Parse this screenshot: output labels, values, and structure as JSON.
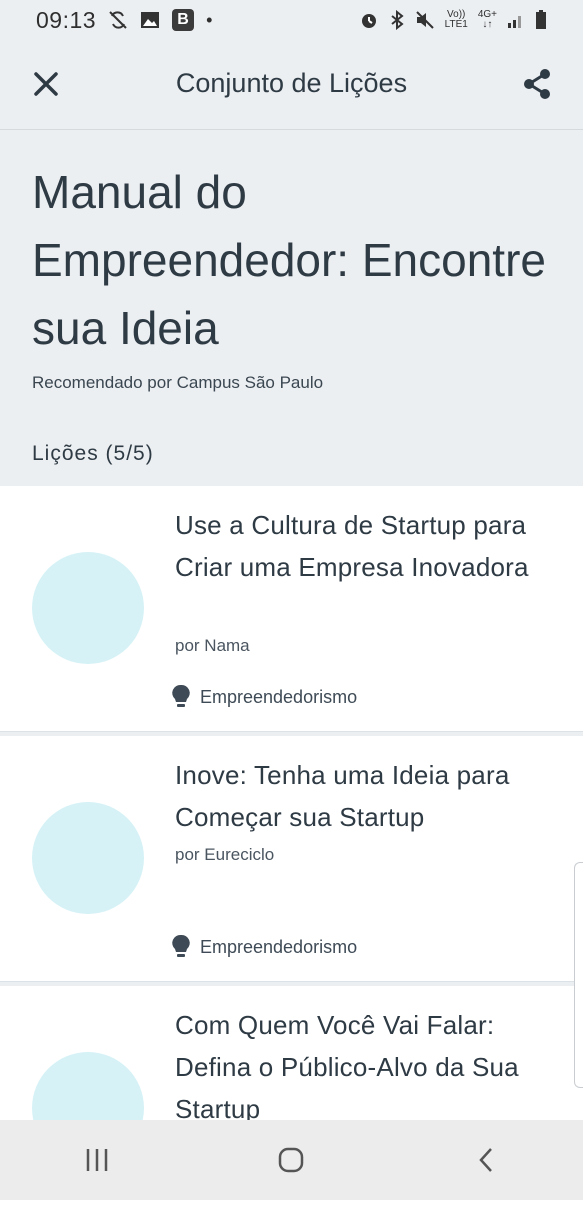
{
  "status_bar": {
    "time": "09:13",
    "b_label": "B",
    "volte": "Vo))",
    "lte": "LTE1",
    "network": "4G+"
  },
  "app_bar": {
    "title": "Conjunto de Lições"
  },
  "header": {
    "title": "Manual do Empreendedor: Encontre sua Ideia",
    "recommended_by": "Recomendado por Campus São Paulo",
    "lessons_label": "Lições (5/5)"
  },
  "lessons": [
    {
      "title": "Use a Cultura de Startup para Criar uma Empresa Inovadora",
      "author": "por Nama",
      "tag": "Empreendedorismo"
    },
    {
      "title": "Inove: Tenha uma Ideia para Começar sua Startup",
      "author": "por Eureciclo",
      "tag": "Empreendedorismo"
    },
    {
      "title": "Com Quem Você Vai Falar: Defina o Público-Alvo da Sua Startup",
      "author": "",
      "tag": ""
    }
  ],
  "colors": {
    "background": "#eceff2",
    "card": "#ffffff",
    "thumbnail": "#d6f2f6",
    "text": "#2e3a44"
  },
  "icons": {
    "close": "close-icon",
    "share": "share-icon",
    "tag": "lightbulb-icon",
    "nav_recents": "recents-icon",
    "nav_home": "home-icon",
    "nav_back": "back-icon"
  }
}
